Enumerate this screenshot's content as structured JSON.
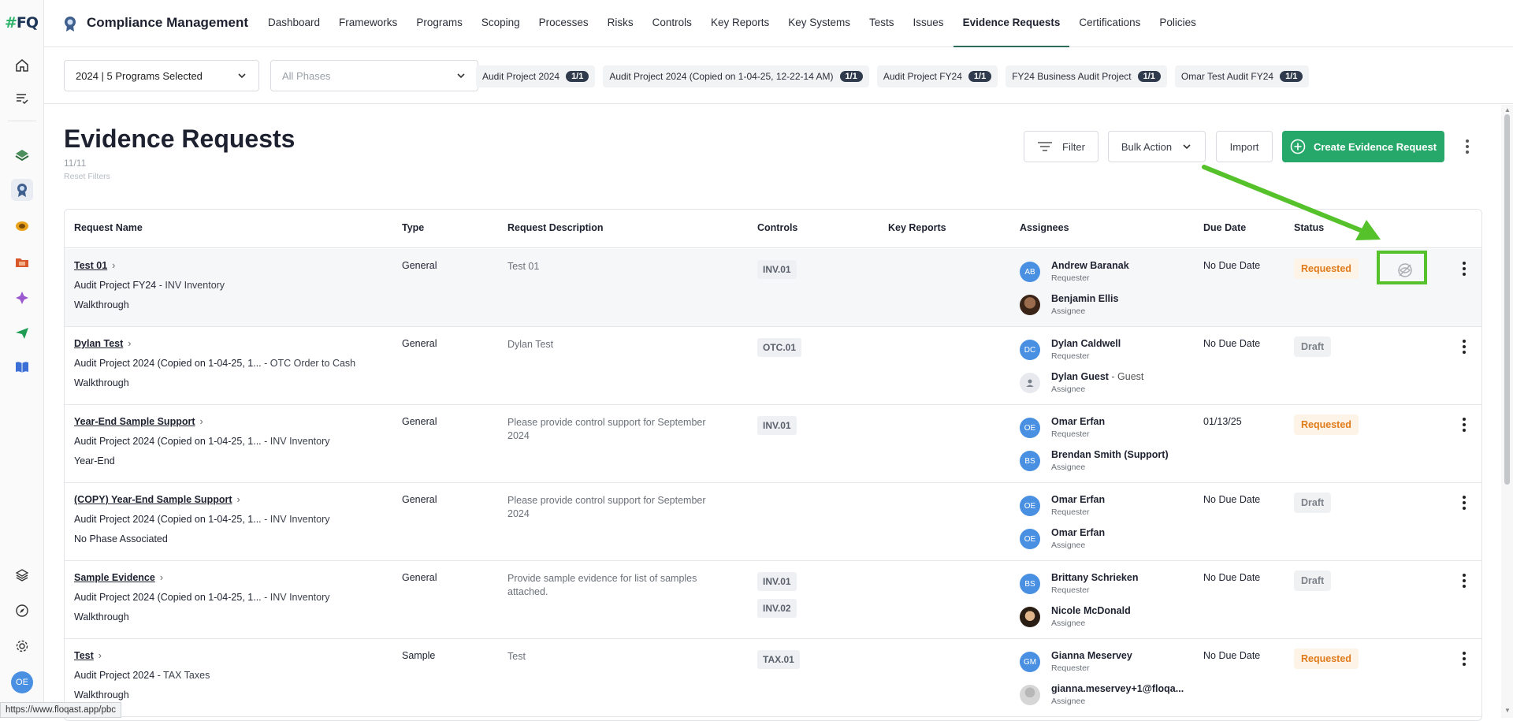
{
  "app": {
    "logo": "#FQ",
    "title": "Compliance Management"
  },
  "nav": {
    "items": [
      {
        "label": "Dashboard"
      },
      {
        "label": "Frameworks"
      },
      {
        "label": "Programs"
      },
      {
        "label": "Scoping"
      },
      {
        "label": "Processes"
      },
      {
        "label": "Risks"
      },
      {
        "label": "Controls"
      },
      {
        "label": "Key Reports"
      },
      {
        "label": "Key Systems"
      },
      {
        "label": "Tests"
      },
      {
        "label": "Issues"
      },
      {
        "label": "Evidence Requests",
        "active": true
      },
      {
        "label": "Certifications"
      },
      {
        "label": "Policies"
      }
    ]
  },
  "filters": {
    "program_select": "2024 | 5 Programs Selected",
    "phase_select_placeholder": "All Phases",
    "chips": [
      {
        "label": "Audit Project 2024",
        "count": "1/1"
      },
      {
        "label": "Audit Project 2024 (Copied on 1-04-25, 12-22-14 AM)",
        "count": "1/1"
      },
      {
        "label": "Audit Project FY24",
        "count": "1/1"
      },
      {
        "label": "FY24 Business Audit Project",
        "count": "1/1"
      },
      {
        "label": "Omar Test Audit FY24",
        "count": "1/1"
      }
    ]
  },
  "page": {
    "title": "Evidence Requests",
    "count": "11/11",
    "reset_filters": "Reset Filters",
    "filter_label": "Filter",
    "bulk_action_label": "Bulk Action",
    "import_label": "Import",
    "create_label": "Create Evidence Request"
  },
  "table": {
    "headers": {
      "name": "Request Name",
      "type": "Type",
      "description": "Request Description",
      "controls": "Controls",
      "key_reports": "Key Reports",
      "assignees": "Assignees",
      "due_date": "Due Date",
      "status": "Status"
    },
    "rows": [
      {
        "name": "Test 01",
        "project": "Audit Project FY24",
        "area": " - INV Inventory",
        "phase": "Walkthrough",
        "type": "General",
        "description": "Test 01",
        "controls": [
          "INV.01"
        ],
        "people": [
          {
            "initials": "AB",
            "name": "Andrew Baranak",
            "role": "Requester",
            "avatar": "initials"
          },
          {
            "initials": "",
            "name": "Benjamin Ellis",
            "role": "Assignee",
            "avatar": "photo1"
          }
        ],
        "due": "No Due Date",
        "status": "Requested",
        "status_kind": "requested",
        "show_eye_off": true
      },
      {
        "name": "Dylan Test",
        "project": "Audit Project 2024 (Copied on 1-04-25, 1...",
        "area": " - OTC Order to Cash",
        "phase": "Walkthrough",
        "type": "General",
        "description": "Dylan Test",
        "controls": [
          "OTC.01"
        ],
        "people": [
          {
            "initials": "DC",
            "name": "Dylan Caldwell",
            "role": "Requester",
            "avatar": "initials"
          },
          {
            "initials": "",
            "name": "Dylan Guest",
            "guest_tag": " - Guest",
            "role": "Assignee",
            "avatar": "guest"
          }
        ],
        "due": "No Due Date",
        "status": "Draft",
        "status_kind": "draft"
      },
      {
        "name": "Year-End Sample Support",
        "project": "Audit Project 2024 (Copied on 1-04-25, 1...",
        "area": " - INV Inventory",
        "phase": "Year-End",
        "type": "General",
        "description": "Please provide control support for September 2024",
        "controls": [
          "INV.01"
        ],
        "people": [
          {
            "initials": "OE",
            "name": "Omar Erfan",
            "role": "Requester",
            "avatar": "initials"
          },
          {
            "initials": "BS",
            "name": "Brendan Smith (Support)",
            "role": "Assignee",
            "avatar": "initials"
          }
        ],
        "due": "01/13/25",
        "status": "Requested",
        "status_kind": "requested"
      },
      {
        "name": "(COPY) Year-End Sample Support",
        "project": "Audit Project 2024 (Copied on 1-04-25, 1...",
        "area": " - INV Inventory",
        "phase": "No Phase Associated",
        "type": "General",
        "description": "Please provide control support for September 2024",
        "controls": [],
        "people": [
          {
            "initials": "OE",
            "name": "Omar Erfan",
            "role": "Requester",
            "avatar": "initials"
          },
          {
            "initials": "OE",
            "name": "Omar Erfan",
            "role": "Assignee",
            "avatar": "initials"
          }
        ],
        "due": "No Due Date",
        "status": "Draft",
        "status_kind": "draft"
      },
      {
        "name": "Sample Evidence",
        "project": "Audit Project 2024 (Copied on 1-04-25, 1...",
        "area": " - INV Inventory",
        "phase": "Walkthrough",
        "type": "General",
        "description": "Provide sample evidence for list of samples attached.",
        "controls": [
          "INV.01",
          "INV.02"
        ],
        "people": [
          {
            "initials": "BS",
            "name": "Brittany Schrieken",
            "role": "Requester",
            "avatar": "initials"
          },
          {
            "initials": "",
            "name": "Nicole McDonald",
            "role": "Assignee",
            "avatar": "photo2"
          }
        ],
        "due": "No Due Date",
        "status": "Draft",
        "status_kind": "draft"
      },
      {
        "name": "Test",
        "project": "Audit Project 2024",
        "area": " - TAX Taxes",
        "phase": "Walkthrough",
        "type": "Sample",
        "description": "Test",
        "controls": [
          "TAX.01"
        ],
        "people": [
          {
            "initials": "GM",
            "name": "Gianna Meservey",
            "role": "Requester",
            "avatar": "initials"
          },
          {
            "initials": "",
            "name": "gianna.meservey+1@floqa...",
            "role": "Assignee",
            "avatar": "photo3"
          }
        ],
        "due": "No Due Date",
        "status": "Requested",
        "status_kind": "requested"
      }
    ]
  },
  "user": {
    "initials": "OE"
  },
  "status_bar_url": "https://www.floqast.app/pbc",
  "colors": {
    "accent": "#27a86b",
    "annotation": "#55c12b",
    "requested": "#e07b1a"
  }
}
